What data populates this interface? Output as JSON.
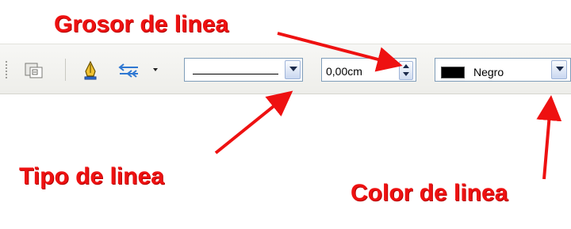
{
  "annotations": {
    "line_width": "Grosor de linea",
    "line_style": "Tipo de linea",
    "line_color": "Color de linea",
    "accent_color": "#ee1111"
  },
  "toolbar": {
    "icons": [
      "toolbar-grip",
      "object-properties-icon",
      "line-icon",
      "arrow-style-icon",
      "dropdown-arrow-icon"
    ],
    "line_style": {
      "selected": "continuous-line"
    },
    "line_width": {
      "value": "0,00cm"
    },
    "line_color": {
      "swatch": "#000000",
      "value": "Negro"
    }
  }
}
